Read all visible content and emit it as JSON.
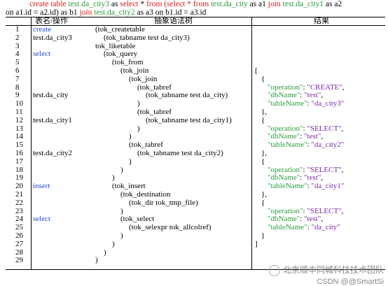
{
  "query": {
    "line1": [
      {
        "t": "create table ",
        "c": "red"
      },
      {
        "t": "test.da_city3",
        "c": "grn"
      },
      {
        "t": " as ",
        "c": "blk"
      },
      {
        "t": "select",
        "c": "red"
      },
      {
        "t": " * ",
        "c": "blk"
      },
      {
        "t": "from",
        "c": "red"
      },
      {
        "t": " (select    * ",
        "c": "red"
      },
      {
        "t": "from",
        "c": "red"
      },
      {
        "t": " test.da_city",
        "c": "grn"
      },
      {
        "t": " as a1 ",
        "c": "blk"
      },
      {
        "t": "join",
        "c": "red"
      },
      {
        "t": "     test.da_city1",
        "c": "grn"
      },
      {
        "t": " as a2",
        "c": "blk"
      }
    ],
    "line2": [
      {
        "t": "on a1.id = a2.id) as b1 ",
        "c": "blk"
      },
      {
        "t": "join",
        "c": "red"
      },
      {
        "t": " test.da_city2",
        "c": "grn"
      },
      {
        "t": " as a3 on b1.id = a3.id",
        "c": "blk"
      }
    ]
  },
  "headers": {
    "name": "表名/操作",
    "tree": "抽象语法树",
    "result": "结果"
  },
  "rows": [
    {
      "n": "1",
      "name": "create",
      "blue": true,
      "tree": "(tok_createtable",
      "ind": 0
    },
    {
      "n": "2",
      "name": "test.da_city3",
      "blue": false,
      "tree": "(tok_tabname test da_city3)",
      "ind": 1
    },
    {
      "n": "3",
      "name": "",
      "blue": false,
      "tree": "tok_liketable",
      "ind": 0
    },
    {
      "n": "4",
      "name": "select",
      "blue": true,
      "tree": "(tok_query",
      "ind": 1
    },
    {
      "n": "5",
      "name": "",
      "blue": false,
      "tree": "(tok_from",
      "ind": 2
    },
    {
      "n": "6",
      "name": "",
      "blue": false,
      "tree": "(tok_join",
      "ind": 3
    },
    {
      "n": "7",
      "name": "",
      "blue": false,
      "tree": "(tok_join",
      "ind": 4
    },
    {
      "n": "8",
      "name": "",
      "blue": false,
      "tree": "(tok_tabref",
      "ind": 5
    },
    {
      "n": "9",
      "name": "test.da_city",
      "blue": false,
      "tree": "(tok_tabname test da_city)",
      "ind": 6
    },
    {
      "n": "10",
      "name": "",
      "blue": false,
      "tree": ")",
      "ind": 5
    },
    {
      "n": "11",
      "name": "",
      "blue": false,
      "tree": "(tok_tabref",
      "ind": 5
    },
    {
      "n": "12",
      "name": "test.da_city1",
      "blue": false,
      "tree": "(tok_tabname test da_city1)",
      "ind": 6
    },
    {
      "n": "13",
      "name": "",
      "blue": false,
      "tree": ")",
      "ind": 5
    },
    {
      "n": "14",
      "name": "",
      "blue": false,
      "tree": ")",
      "ind": 4
    },
    {
      "n": "15",
      "name": "",
      "blue": false,
      "tree": "(tok_tabref",
      "ind": 4
    },
    {
      "n": "16",
      "name": "test.da_city2",
      "blue": false,
      "tree": "(tok_tabname test da_city2)",
      "ind": 5
    },
    {
      "n": "17",
      "name": "",
      "blue": false,
      "tree": ")",
      "ind": 4
    },
    {
      "n": "18",
      "name": "",
      "blue": false,
      "tree": ")",
      "ind": 3
    },
    {
      "n": "19",
      "name": "",
      "blue": false,
      "tree": ")",
      "ind": 2
    },
    {
      "n": "20",
      "name": "insert",
      "blue": true,
      "tree": "(tok_insert",
      "ind": 2
    },
    {
      "n": "21",
      "name": "",
      "blue": false,
      "tree": "(tok_destination",
      "ind": 3
    },
    {
      "n": "22",
      "name": "",
      "blue": false,
      "tree": "(tok_dir tok_tmp_file)",
      "ind": 4
    },
    {
      "n": "23",
      "name": "",
      "blue": false,
      "tree": ")",
      "ind": 3
    },
    {
      "n": "24",
      "name": "select",
      "blue": true,
      "tree": "(tok_select",
      "ind": 3
    },
    {
      "n": "25",
      "name": "",
      "blue": false,
      "tree": "(tok_selexpr tok_allcolref)",
      "ind": 4
    },
    {
      "n": "26",
      "name": "",
      "blue": false,
      "tree": ")",
      "ind": 3
    },
    {
      "n": "27",
      "name": "",
      "blue": false,
      "tree": ")",
      "ind": 2
    },
    {
      "n": "28",
      "name": "",
      "blue": false,
      "tree": ")",
      "ind": 1
    },
    {
      "n": "29",
      "name": "",
      "blue": false,
      "tree": ")",
      "ind": 0
    }
  ],
  "result": [
    {
      "row": 6,
      "ind": 0,
      "parts": [
        {
          "t": "[",
          "c": ""
        }
      ]
    },
    {
      "row": 7,
      "ind": 1,
      "parts": [
        {
          "t": "{",
          "c": ""
        }
      ]
    },
    {
      "row": 8,
      "ind": 2,
      "parts": [
        {
          "t": "\"operation\"",
          "c": "k"
        },
        {
          "t": ": ",
          "c": ""
        },
        {
          "t": "\"CREATE\"",
          "c": "s"
        },
        {
          "t": ",",
          "c": ""
        }
      ]
    },
    {
      "row": 9,
      "ind": 2,
      "parts": [
        {
          "t": "\"dbName\"",
          "c": "k"
        },
        {
          "t": ": ",
          "c": ""
        },
        {
          "t": "\"test\"",
          "c": "s"
        },
        {
          "t": ",",
          "c": ""
        }
      ]
    },
    {
      "row": 10,
      "ind": 2,
      "parts": [
        {
          "t": "\"tableName\"",
          "c": "k"
        },
        {
          "t": ": ",
          "c": ""
        },
        {
          "t": "\"da_city3\"",
          "c": "s"
        }
      ]
    },
    {
      "row": 11,
      "ind": 1,
      "parts": [
        {
          "t": "},",
          "c": ""
        }
      ]
    },
    {
      "row": 12,
      "ind": 1,
      "parts": [
        {
          "t": "{",
          "c": ""
        }
      ]
    },
    {
      "row": 13,
      "ind": 2,
      "parts": [
        {
          "t": "\"operation\"",
          "c": "k"
        },
        {
          "t": ": ",
          "c": ""
        },
        {
          "t": "\"SELECT\"",
          "c": "s"
        },
        {
          "t": ",",
          "c": ""
        }
      ]
    },
    {
      "row": 14,
      "ind": 2,
      "parts": [
        {
          "t": "\"dbName\"",
          "c": "k"
        },
        {
          "t": ": ",
          "c": ""
        },
        {
          "t": "\"test\"",
          "c": "s"
        },
        {
          "t": ",",
          "c": ""
        }
      ]
    },
    {
      "row": 15,
      "ind": 2,
      "parts": [
        {
          "t": "\"tableName\"",
          "c": "k"
        },
        {
          "t": ": ",
          "c": ""
        },
        {
          "t": "\"da_city2\"",
          "c": "s"
        }
      ]
    },
    {
      "row": 16,
      "ind": 1,
      "parts": [
        {
          "t": "},",
          "c": ""
        }
      ]
    },
    {
      "row": 17,
      "ind": 1,
      "parts": [
        {
          "t": "{",
          "c": ""
        }
      ]
    },
    {
      "row": 18,
      "ind": 2,
      "parts": [
        {
          "t": "\"operation\"",
          "c": "k"
        },
        {
          "t": ": ",
          "c": ""
        },
        {
          "t": "\"SELECT\"",
          "c": "s"
        },
        {
          "t": ",",
          "c": ""
        }
      ]
    },
    {
      "row": 19,
      "ind": 2,
      "parts": [
        {
          "t": "\"dbName\"",
          "c": "k"
        },
        {
          "t": ": ",
          "c": ""
        },
        {
          "t": "\"test\"",
          "c": "s"
        },
        {
          "t": ",",
          "c": ""
        }
      ]
    },
    {
      "row": 20,
      "ind": 2,
      "parts": [
        {
          "t": "\"tableName\"",
          "c": "k"
        },
        {
          "t": ": ",
          "c": ""
        },
        {
          "t": "\"da_city1\"",
          "c": "s"
        }
      ]
    },
    {
      "row": 21,
      "ind": 1,
      "parts": [
        {
          "t": "},",
          "c": ""
        }
      ]
    },
    {
      "row": 22,
      "ind": 1,
      "parts": [
        {
          "t": "{",
          "c": ""
        }
      ]
    },
    {
      "row": 23,
      "ind": 2,
      "parts": [
        {
          "t": "\"operation\"",
          "c": "k"
        },
        {
          "t": ": ",
          "c": ""
        },
        {
          "t": "\"SELECT\"",
          "c": "s"
        },
        {
          "t": ",",
          "c": ""
        }
      ]
    },
    {
      "row": 24,
      "ind": 2,
      "parts": [
        {
          "t": "\"dbName\"",
          "c": "k"
        },
        {
          "t": ": ",
          "c": ""
        },
        {
          "t": "\"test\"",
          "c": "s"
        },
        {
          "t": ",",
          "c": ""
        }
      ]
    },
    {
      "row": 25,
      "ind": 2,
      "parts": [
        {
          "t": "\"tableName\"",
          "c": "k"
        },
        {
          "t": ": ",
          "c": ""
        },
        {
          "t": "\"da_city\"",
          "c": "s"
        }
      ]
    },
    {
      "row": 26,
      "ind": 1,
      "parts": [
        {
          "t": "}",
          "c": ""
        }
      ]
    },
    {
      "row": 27,
      "ind": 0,
      "parts": [
        {
          "t": "]",
          "c": ""
        }
      ]
    }
  ],
  "watermark": "北京顺丰同城科技技术团队",
  "credit": "CSDN @@SmartSi"
}
